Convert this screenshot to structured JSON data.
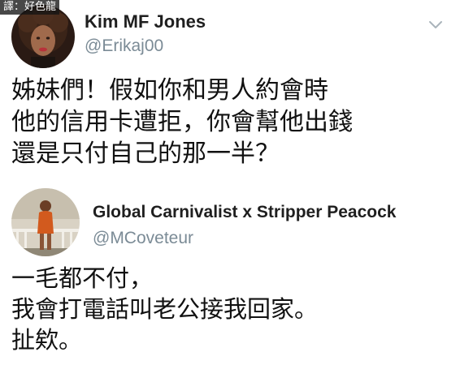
{
  "watermark": "譯：好色龍",
  "tweets": [
    {
      "author_name": "Kim MF Jones",
      "author_handle": "@Erikaj00",
      "body_lines": [
        "姊妹們！假如你和男人約會時",
        "他的信用卡遭拒，你會幫他出錢",
        "還是只付自己的那一半？"
      ],
      "menu_icon": "chevron-down-icon"
    },
    {
      "author_name": "Global Carnivalist x Stripper Peacock",
      "author_handle": "@MCoveteur",
      "body_lines": [
        "一毛都不付，",
        "我會打電話叫老公接我回家。",
        "扯欸。"
      ]
    }
  ],
  "colors": {
    "name": "#1f1f1f",
    "handle": "#7b8b96",
    "body": "#111111",
    "chevron": "#aab4bb"
  }
}
